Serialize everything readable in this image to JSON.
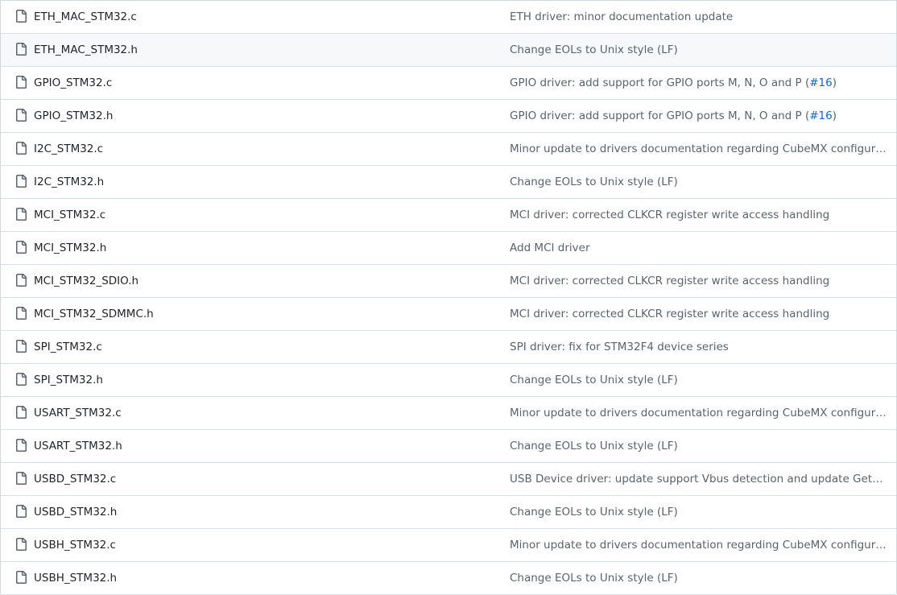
{
  "files": [
    {
      "name": "ETH_MAC_STM32.c",
      "message": "ETH driver: minor documentation update"
    },
    {
      "name": "ETH_MAC_STM32.h",
      "message": "Change EOLs to Unix style (LF)"
    },
    {
      "name": "GPIO_STM32.c",
      "message": "GPIO driver: add support for GPIO ports M, N, O and P (",
      "issue": "#16",
      "suffix": ")"
    },
    {
      "name": "GPIO_STM32.h",
      "message": "GPIO driver: add support for GPIO ports M, N, O and P (",
      "issue": "#16",
      "suffix": ")"
    },
    {
      "name": "I2C_STM32.c",
      "message": "Minor update to drivers documentation regarding CubeMX configuration"
    },
    {
      "name": "I2C_STM32.h",
      "message": "Change EOLs to Unix style (LF)"
    },
    {
      "name": "MCI_STM32.c",
      "message": "MCI driver: corrected CLKCR register write access handling"
    },
    {
      "name": "MCI_STM32.h",
      "message": "Add MCI driver"
    },
    {
      "name": "MCI_STM32_SDIO.h",
      "message": "MCI driver: corrected CLKCR register write access handling"
    },
    {
      "name": "MCI_STM32_SDMMC.h",
      "message": "MCI driver: corrected CLKCR register write access handling"
    },
    {
      "name": "SPI_STM32.c",
      "message": "SPI driver: fix for STM32F4 device series"
    },
    {
      "name": "SPI_STM32.h",
      "message": "Change EOLs to Unix style (LF)"
    },
    {
      "name": "USART_STM32.c",
      "message": "Minor update to drivers documentation regarding CubeMX configuration"
    },
    {
      "name": "USART_STM32.h",
      "message": "Change EOLs to Unix style (LF)"
    },
    {
      "name": "USBD_STM32.c",
      "message": "USB Device driver: update support Vbus detection and update GetFrameN..."
    },
    {
      "name": "USBD_STM32.h",
      "message": "Change EOLs to Unix style (LF)"
    },
    {
      "name": "USBH_STM32.c",
      "message": "Minor update to drivers documentation regarding CubeMX configuration"
    },
    {
      "name": "USBH_STM32.h",
      "message": "Change EOLs to Unix style (LF)"
    }
  ],
  "colors": {
    "file_text": "#1f2328",
    "message_text": "#59636e",
    "link": "#0969da",
    "border": "#d8dee4",
    "hover_bg": "#f6f8fa"
  },
  "icons": {
    "file": "file-icon"
  }
}
